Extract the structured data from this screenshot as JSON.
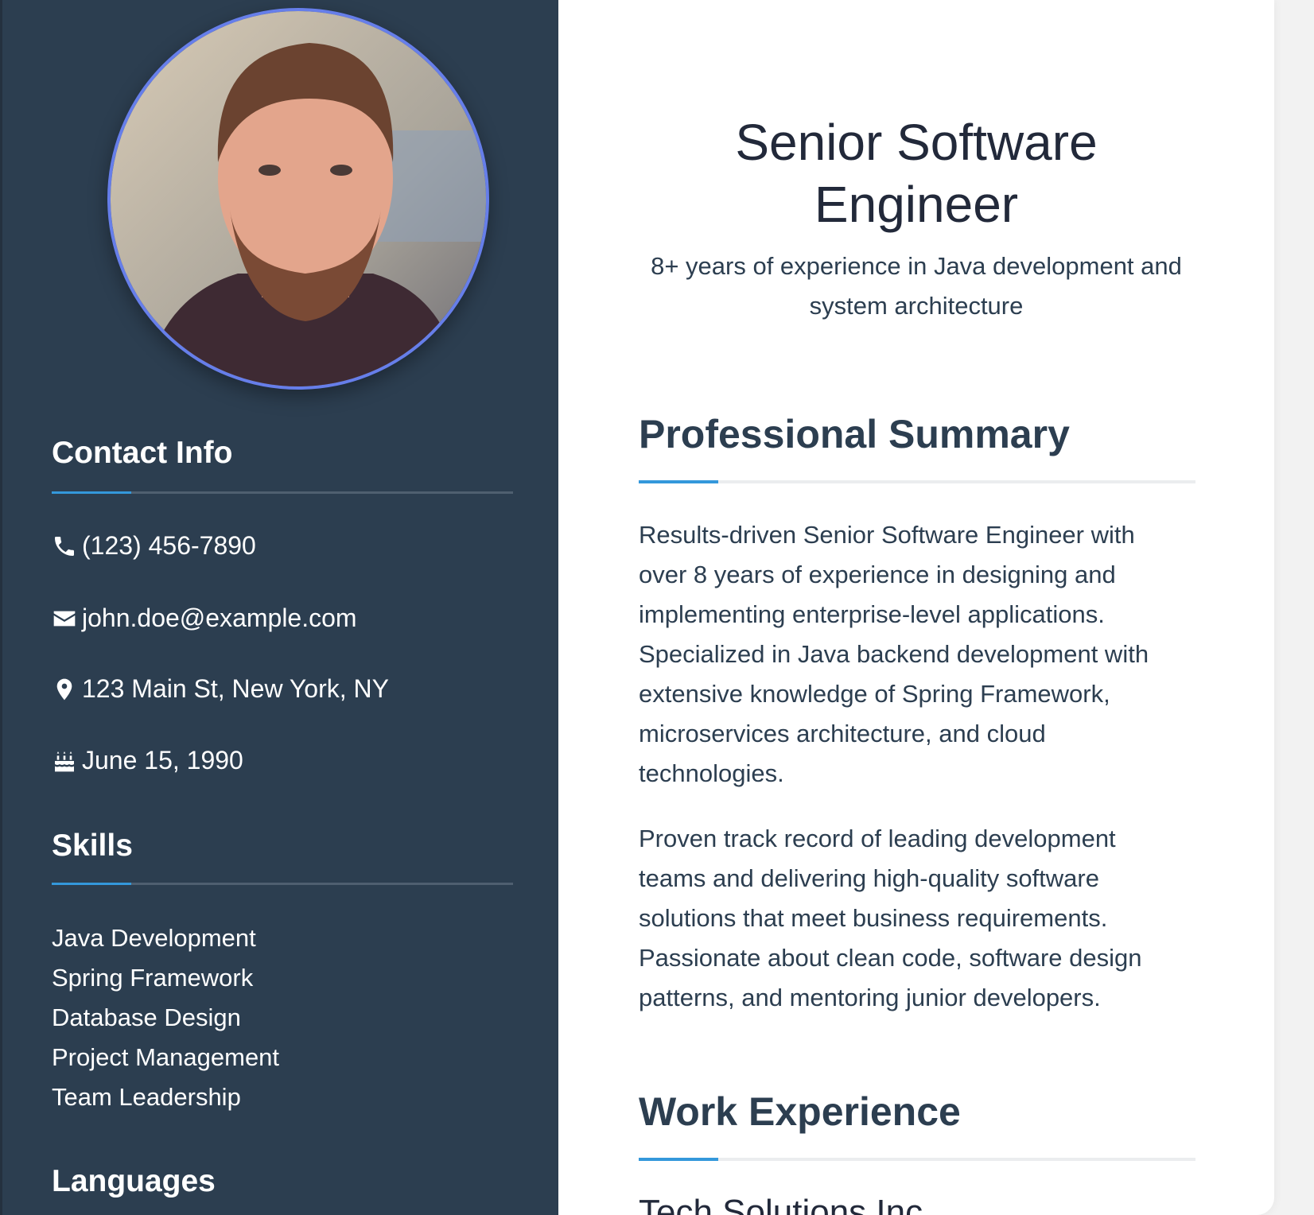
{
  "sidebar": {
    "contact_heading": "Contact Info",
    "contact": [
      {
        "icon": "phone-icon",
        "text": "(123) 456-7890"
      },
      {
        "icon": "envelope-icon",
        "text": "john.doe@example.com"
      },
      {
        "icon": "map-marker-icon",
        "text": "123 Main St, New York, NY"
      },
      {
        "icon": "birthday-cake-icon",
        "text": "June 15, 1990"
      }
    ],
    "skills_heading": "Skills",
    "skills": [
      "Java Development",
      "Spring Framework",
      "Database Design",
      "Project Management",
      "Team Leadership"
    ],
    "languages_heading": "Languages"
  },
  "main": {
    "title": "Senior Software Engineer",
    "subtitle": "8+ years of experience in Java development and system architecture",
    "summary_heading": "Professional Summary",
    "summary": [
      "Results-driven Senior Software Engineer with over 8 years of experience in designing and implementing enterprise-level applications. Specialized in Java backend development with extensive knowledge of Spring Framework, microservices architecture, and cloud technologies.",
      "Proven track record of leading development teams and delivering high-quality software solutions that meet business requirements. Passionate about clean code, software design patterns, and mentoring junior developers."
    ],
    "experience_heading": "Work Experience",
    "company": "Tech Solutions Inc."
  },
  "colors": {
    "sidebar": "#2c3e50",
    "accent": "#3498db",
    "avatar_border": "#667eea"
  }
}
